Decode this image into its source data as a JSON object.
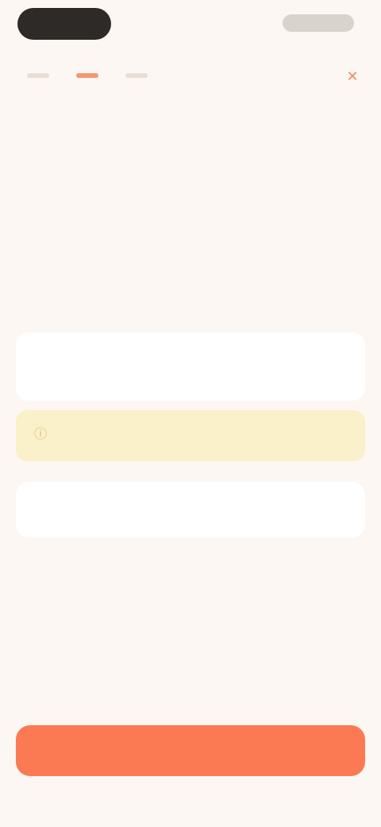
{
  "status_bar": {
    "time": "",
    "right": ""
  },
  "steps": {
    "active_index": 1,
    "count": 3
  },
  "icons": {
    "close": "close-icon",
    "info": "info-icon"
  },
  "colors": {
    "accent": "#fb7a53",
    "notice_bg": "#faf0c9",
    "background": "#fcf7f2"
  },
  "header": {
    "title": ""
  },
  "amount": {
    "main": "",
    "sub": "",
    "sub2": ""
  },
  "detail": {
    "label": "",
    "value": ""
  },
  "notice": {
    "text": ""
  },
  "secondary_action": {
    "label": ""
  },
  "primary_action": {
    "label": ""
  }
}
